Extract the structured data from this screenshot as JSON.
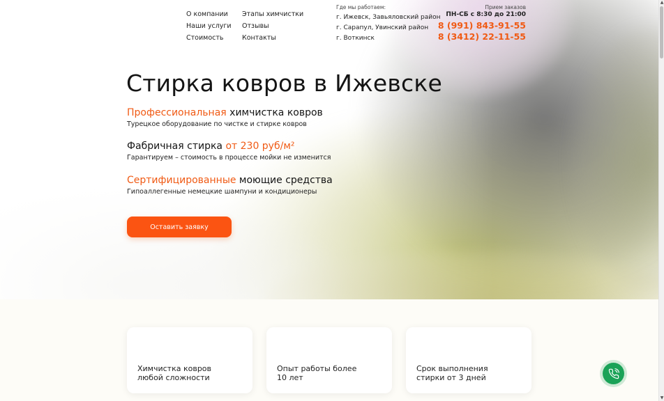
{
  "nav": {
    "col1": [
      "О компании",
      "Наши услуги",
      "Стоимость"
    ],
    "col2": [
      "Этапы химчистки",
      "Отзывы",
      "Контакты"
    ]
  },
  "locations": {
    "caption": "Где мы работаем:",
    "items": [
      "г. Ижевск, Завьяловский район",
      "г. Сарапул, Увинский район",
      "г. Воткинск"
    ]
  },
  "contacts": {
    "caption": "Прием заказов",
    "hours": "ПН-СБ с 8:30 до 21:00",
    "phones": [
      "8 (991) 843-91-55",
      "8 (3412) 22-11-55"
    ]
  },
  "hero": {
    "title": "Стирка ковров в Ижевске",
    "features": [
      {
        "pre": "",
        "accent": "Профессиональная",
        "post": " химчистка ковров",
        "sub": "Турецкое оборудование по чистке и стирке ковров"
      },
      {
        "pre": "Фабричная стирка ",
        "accent": "от 230 руб/м²",
        "post": "",
        "sub": "Гарантируем – стоимость в процессе мойки не изменится"
      },
      {
        "pre": "",
        "accent": "Сертифицированные",
        "post": " моющие средства",
        "sub": "Гипоаллегенные немецкие шампуни и кондиционеры"
      }
    ],
    "cta": "Оставить заявку"
  },
  "cards": [
    {
      "line1": "Химчистка ковров",
      "line2": "любой сложности"
    },
    {
      "line1": "Опыт работы более",
      "line2": "10 лет"
    },
    {
      "line1": "Срок выполнения",
      "line2": "стирки от 3 дней"
    }
  ],
  "colors": {
    "accent": "#f05a14",
    "button": "#fb5412",
    "call_button": "#1aa257"
  },
  "icons": {
    "call": "phone-icon"
  }
}
